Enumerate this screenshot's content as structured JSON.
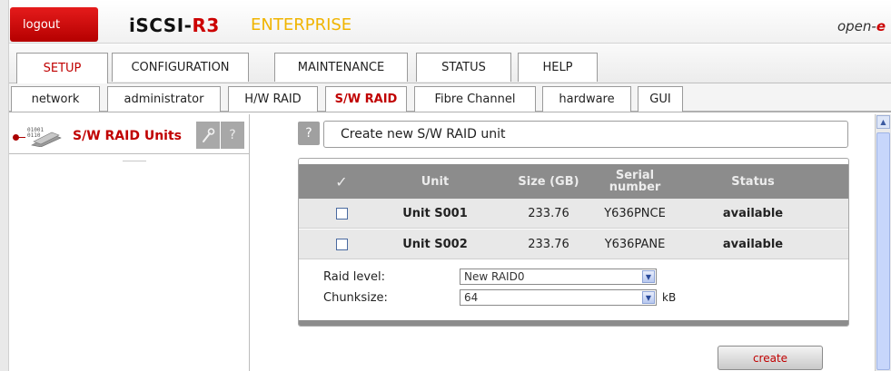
{
  "header": {
    "logout_label": "logout",
    "brand_main": "iSCSI-",
    "brand_accent": "R3",
    "edition": "ENTERPRISE",
    "vendor_main": "open-",
    "vendor_accent": "e"
  },
  "main_tabs": [
    "SETUP",
    "CONFIGURATION",
    "MAINTENANCE",
    "STATUS",
    "HELP"
  ],
  "main_tab_active": "SETUP",
  "sub_tabs": [
    "network",
    "administrator",
    "H/W RAID",
    "S/W RAID",
    "Fibre Channel",
    "hardware",
    "GUI"
  ],
  "sub_tab_active": "S/W RAID",
  "left_panel": {
    "title": "S/W RAID Units",
    "help": "?"
  },
  "content": {
    "help": "?",
    "title": "Create new S/W RAID unit"
  },
  "table": {
    "headers": {
      "check": "✓",
      "unit": "Unit",
      "size": "Size (GB)",
      "serial": "Serial number",
      "status": "Status"
    },
    "rows": [
      {
        "unit": "Unit S001",
        "size": "233.76",
        "serial": "Y636PNCE",
        "status": "available"
      },
      {
        "unit": "Unit S002",
        "size": "233.76",
        "serial": "Y636PANE",
        "status": "available"
      }
    ]
  },
  "form": {
    "raid_label": "Raid level:",
    "raid_value": "New RAID0",
    "chunk_label": "Chunksize:",
    "chunk_value": "64",
    "chunk_unit": "kB"
  },
  "create_label": "create",
  "colors": {
    "accent_red": "#c00000",
    "edition_yellow": "#f0b400",
    "table_header": "#8c8c8c"
  }
}
